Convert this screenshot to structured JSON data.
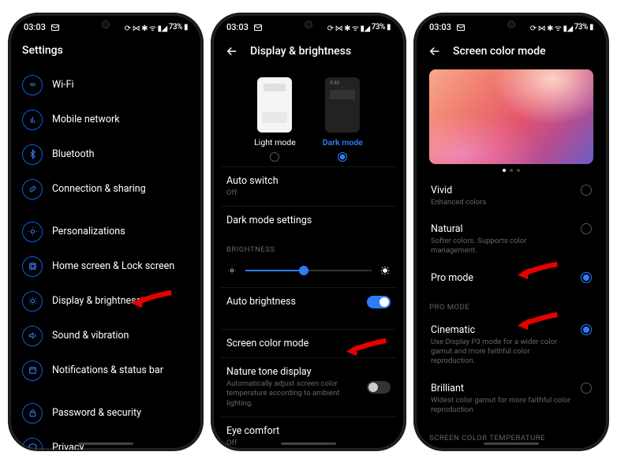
{
  "status": {
    "time": "03:03",
    "battery_text": "73%"
  },
  "accent": "#2f7cf6",
  "screen1": {
    "title": "Settings",
    "items": [
      {
        "label": "Wi-Fi",
        "icon": "wifi-icon"
      },
      {
        "label": "Mobile network",
        "icon": "mobile-icon"
      },
      {
        "label": "Bluetooth",
        "icon": "bluetooth-icon"
      },
      {
        "label": "Connection & sharing",
        "icon": "link-icon"
      },
      {
        "label": "Personalizations",
        "icon": "wallpaper-icon"
      },
      {
        "label": "Home screen & Lock screen",
        "icon": "home-icon"
      },
      {
        "label": "Display & brightness",
        "icon": "brightness-icon"
      },
      {
        "label": "Sound & vibration",
        "icon": "sound-icon"
      },
      {
        "label": "Notifications & status bar",
        "icon": "notification-icon"
      },
      {
        "label": "Password & security",
        "icon": "lock-icon"
      },
      {
        "label": "Privacy",
        "icon": "privacy-icon"
      }
    ]
  },
  "screen2": {
    "title": "Display & brightness",
    "mode": {
      "light_label": "Light mode",
      "dark_label": "Dark mode",
      "selected": "dark"
    },
    "auto_switch": {
      "label": "Auto switch",
      "value": "Off"
    },
    "dark_mode_settings": "Dark mode settings",
    "brightness_section": "BRIGHTNESS",
    "auto_brightness": {
      "label": "Auto brightness",
      "value": true
    },
    "screen_color_mode": "Screen color mode",
    "nature_tone": {
      "label": "Nature tone display",
      "sub": "Automatically adjust screen color temperature according to ambient lighting.",
      "value": false
    },
    "eye_comfort": {
      "label": "Eye comfort",
      "value": "Off"
    }
  },
  "screen3": {
    "title": "Screen color mode",
    "options": [
      {
        "label": "Vivid",
        "sub": "Enhanced colors",
        "selected": false
      },
      {
        "label": "Natural",
        "sub": "Softer colors. Supports color management.",
        "selected": false
      },
      {
        "label": "Pro mode",
        "sub": "",
        "selected": true
      }
    ],
    "pro_section": "PRO MODE",
    "pro_options": [
      {
        "label": "Cinematic",
        "sub": "Use Display P3 mode for a wider color gamut and more faithful color reproduction.",
        "selected": true
      },
      {
        "label": "Brilliant",
        "sub": "Widest color gamut for more faithful color reproduction",
        "selected": false
      }
    ],
    "temp_section": "SCREEN COLOR TEMPERATURE"
  }
}
